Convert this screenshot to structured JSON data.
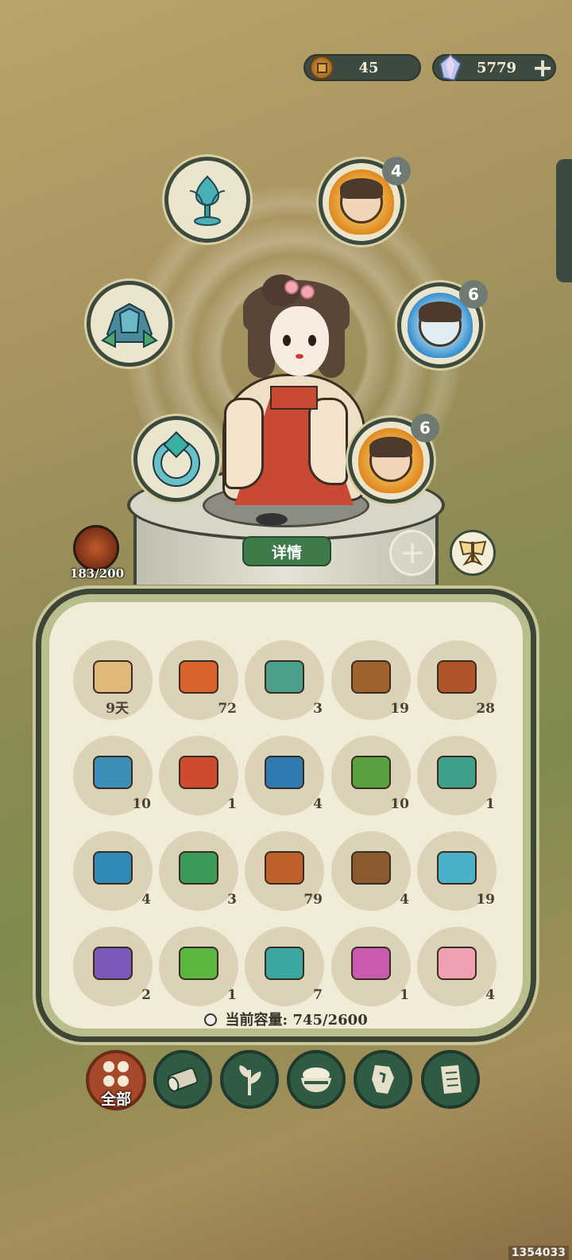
{
  "currency": {
    "coins": "45",
    "gems": "5779"
  },
  "slots": {
    "companion_1_level": "4",
    "companion_2_level": "6",
    "companion_3_level": "6"
  },
  "character": {
    "detail_label": "详情",
    "stamina": "183/200"
  },
  "inventory": {
    "items": [
      {
        "count": "9天",
        "color": "#e0b87a"
      },
      {
        "count": "72",
        "color": "#d9632e"
      },
      {
        "count": "3",
        "color": "#4aa08a"
      },
      {
        "count": "19",
        "color": "#a0622e"
      },
      {
        "count": "28",
        "color": "#b0552a"
      },
      {
        "count": "10",
        "color": "#3b8fb8"
      },
      {
        "count": "1",
        "color": "#d04a2e"
      },
      {
        "count": "4",
        "color": "#2f7ab0"
      },
      {
        "count": "10",
        "color": "#5aa040"
      },
      {
        "count": "1",
        "color": "#3ea08a"
      },
      {
        "count": "4",
        "color": "#2f8ab8"
      },
      {
        "count": "3",
        "color": "#3a9a5a"
      },
      {
        "count": "79",
        "color": "#c0602a"
      },
      {
        "count": "4",
        "color": "#8a5a30"
      },
      {
        "count": "19",
        "color": "#4ab0c8"
      },
      {
        "count": "2",
        "color": "#7a5ab8"
      },
      {
        "count": "1",
        "color": "#5ab840"
      },
      {
        "count": "7",
        "color": "#3aa8a0"
      },
      {
        "count": "1",
        "color": "#c85ab0"
      },
      {
        "count": "4",
        "color": "#f0a0b0"
      }
    ],
    "capacity_label": "当前容量:",
    "capacity_value": "745/2600"
  },
  "tabs": {
    "all_label": "全部"
  },
  "watermark": "1354033",
  "colors": {
    "panel_border": "#3d4634",
    "tab_green": "#2f5a44",
    "tab_active": "#a6482a",
    "detail_button": "#3f7a4a"
  }
}
